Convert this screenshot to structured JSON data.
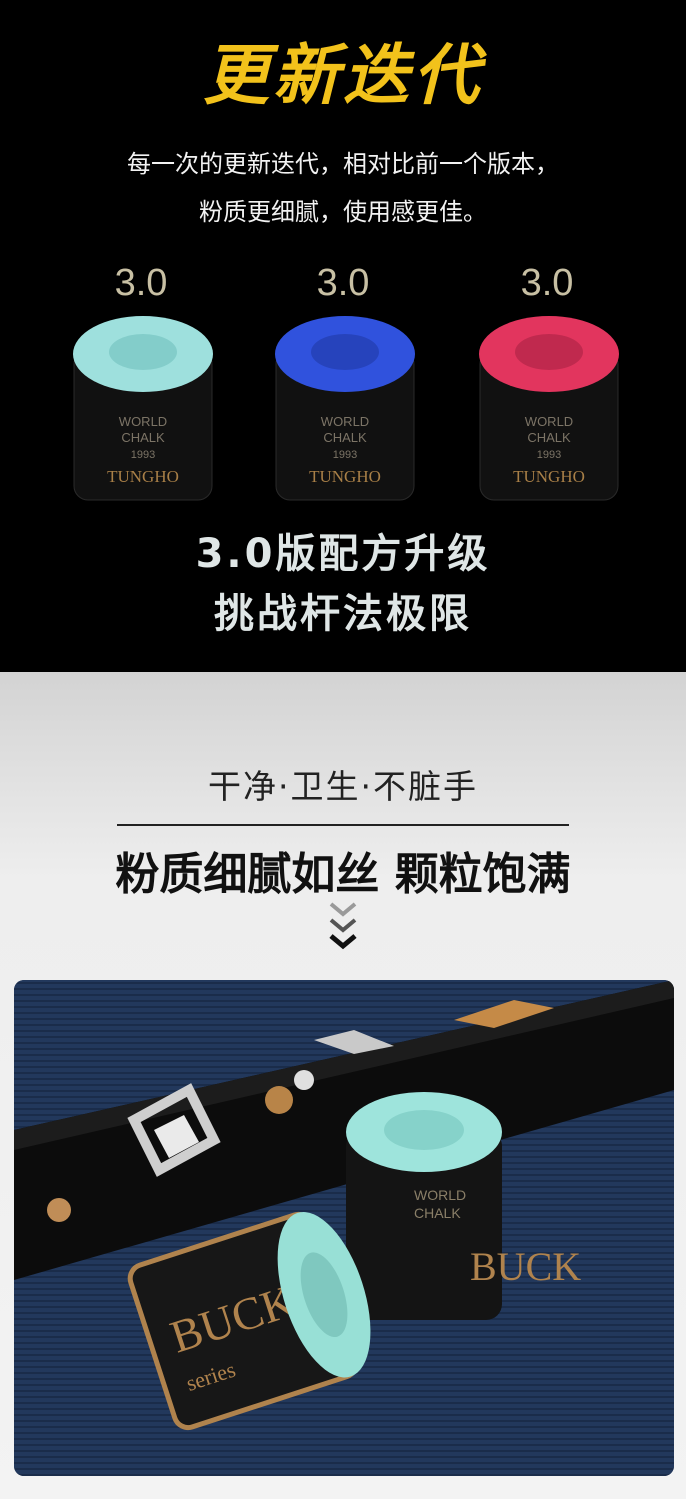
{
  "top": {
    "headline": "更新迭代",
    "intro_lines": [
      "每一次的更新迭代，相对比前一个版本，",
      "粉质更细腻，使用感更佳。"
    ],
    "versions": [
      {
        "label": "3.0",
        "color": "#9ee0dd",
        "shade": "#7cc8c6"
      },
      {
        "label": "3.0",
        "color": "#3052dd",
        "shade": "#2440b4"
      },
      {
        "label": "3.0",
        "color": "#e2355e",
        "shade": "#b8274a"
      }
    ],
    "tagline_lines": [
      "3.0版配方升级",
      "挑战杆法极限"
    ]
  },
  "middle": {
    "features": "干净·卫生·不脏手",
    "bigline": "粉质细腻如丝 颗粒饱满"
  },
  "chalk_wrapper": {
    "line1": "WORLD",
    "line2": "CHALK",
    "line3": "1993",
    "brand": "TUNGHO",
    "logo": "BUCK",
    "series": "series"
  }
}
